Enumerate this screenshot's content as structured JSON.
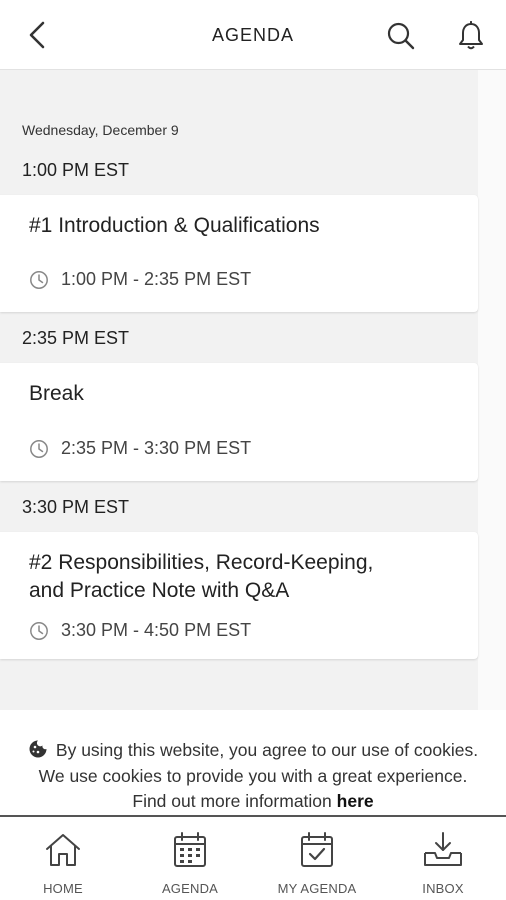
{
  "header": {
    "title": "AGENDA"
  },
  "schedule": {
    "date": "Wednesday, December 9",
    "groups": [
      {
        "time_header": "1:00 PM EST",
        "session_title": "#1 Introduction & Qualifications",
        "session_time": "1:00 PM - 2:35 PM EST"
      },
      {
        "time_header": "2:35 PM EST",
        "session_title": "Break",
        "session_time": "2:35 PM - 3:30 PM EST"
      },
      {
        "time_header": "3:30 PM EST",
        "session_title": "#2 Responsibilities, Record-Keeping, and Practice Note with Q&A",
        "session_time": "3:30 PM - 4:50 PM EST"
      }
    ]
  },
  "cookie_banner": {
    "text": "By using this website, you agree to our use of cookies. We use cookies to provide you with a great experience. Find out more information",
    "link": "here"
  },
  "tabbar": {
    "items": [
      {
        "label": "HOME",
        "icon": "home-icon"
      },
      {
        "label": "AGENDA",
        "icon": "calendar-icon"
      },
      {
        "label": "MY AGENDA",
        "icon": "calendar-check-icon"
      },
      {
        "label": "INBOX",
        "icon": "inbox-icon"
      }
    ]
  }
}
